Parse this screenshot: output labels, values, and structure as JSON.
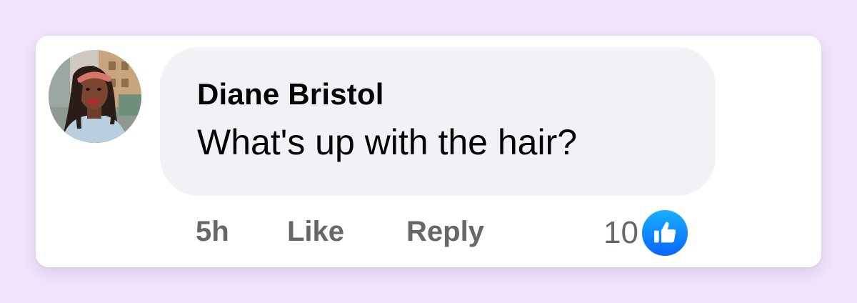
{
  "comment": {
    "author": "Diane Bristol",
    "text": "What's up with the hair?",
    "time": "5h",
    "like_label": "Like",
    "reply_label": "Reply",
    "reaction_count": "10",
    "reaction_icon": "like-thumbs-up-icon"
  },
  "colors": {
    "background": "#f1e4fb",
    "bubble": "#f0f2f5",
    "action_text": "#65676b",
    "like_blue": "#0866ff"
  }
}
